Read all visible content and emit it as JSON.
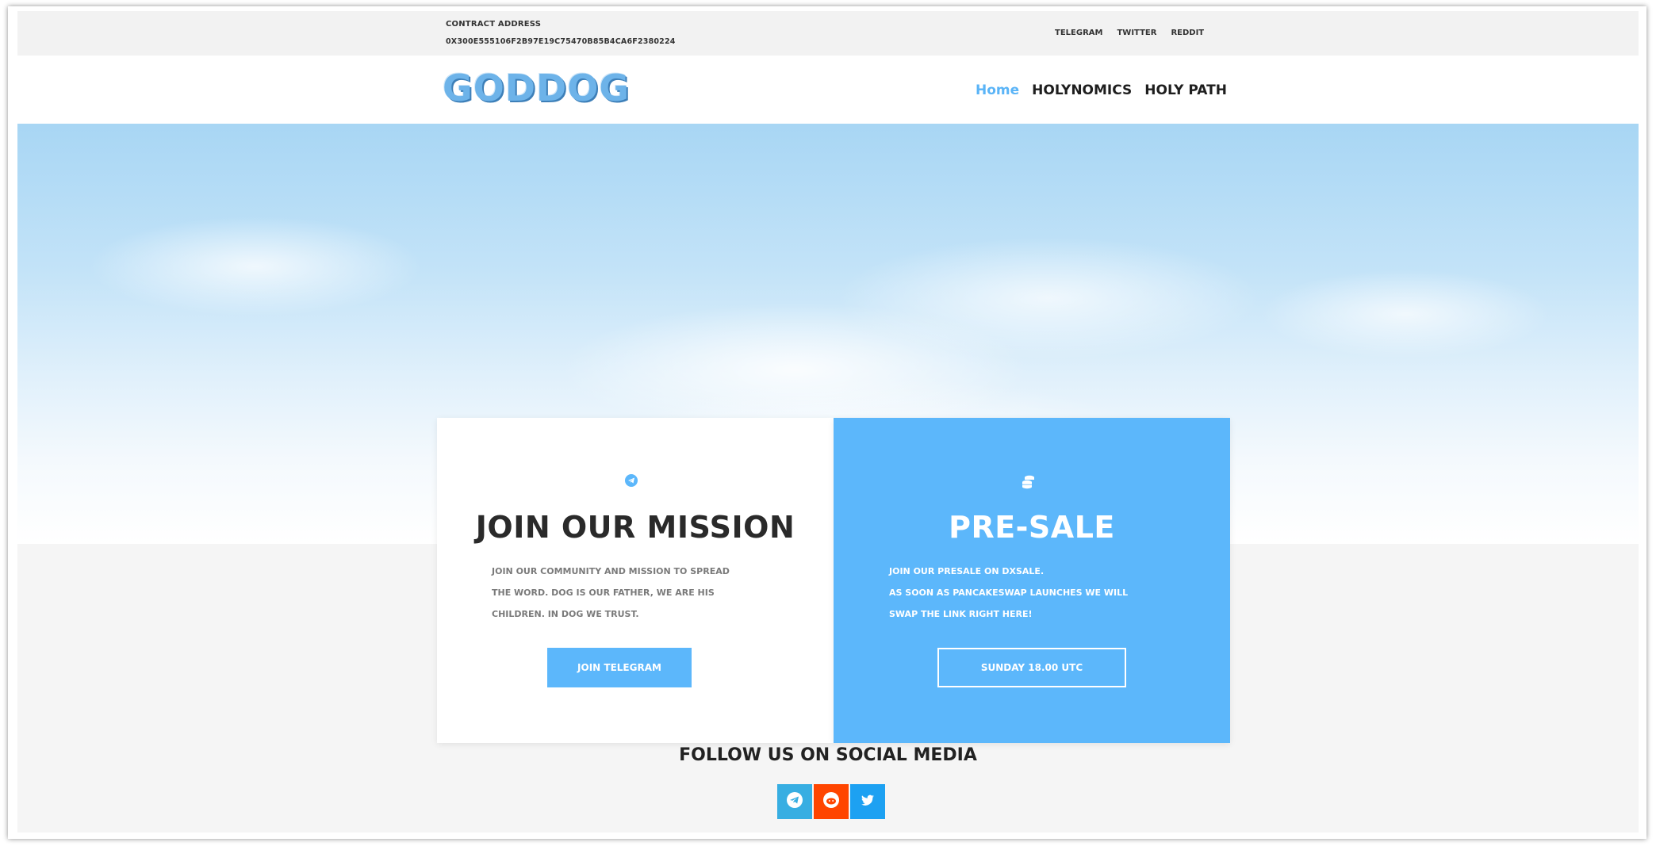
{
  "topbar": {
    "contract_label": "CONTRACT ADDRESS",
    "contract_address": "0X300E555106F2B97E19C75470B85B4CA6F2380224",
    "links": [
      "TELEGRAM",
      "TWITTER",
      "REDDIT"
    ]
  },
  "header": {
    "logo": "GODDOG",
    "nav": [
      "Home",
      "HOLYNOMICS",
      "HOLY PATH"
    ]
  },
  "mission_card": {
    "title": "JOIN OUR MISSION",
    "text_lines": [
      "JOIN OUR COMMUNITY AND MISSION TO SPREAD",
      "THE WORD. DOG IS OUR FATHER, WE ARE HIS",
      "CHILDREN. IN DOG WE TRUST."
    ],
    "button": "JOIN TELEGRAM"
  },
  "presale_card": {
    "title": "PRE-SALE",
    "text_lines": [
      "JOIN OUR PRESALE ON DXSALE.",
      "AS SOON AS PANCAKESWAP LAUNCHES WE WILL",
      "SWAP THE LINK RIGHT HERE!"
    ],
    "button": "SUNDAY 18.00 UTC"
  },
  "social": {
    "heading": "FOLLOW US ON SOCIAL MEDIA",
    "icons": [
      "telegram-icon",
      "reddit-icon",
      "twitter-icon"
    ]
  },
  "colors": {
    "accent": "#5cb7fb",
    "telegram": "#37aee2",
    "reddit": "#ff4500",
    "twitter": "#1da1f2"
  }
}
